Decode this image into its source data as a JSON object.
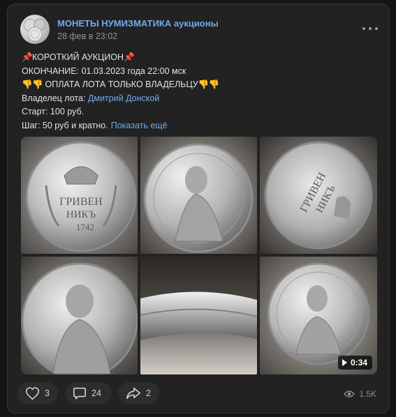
{
  "post": {
    "group_name": "МОНЕТЫ НУМИЗМАТИКА аукционы",
    "date": "28 фев в 23:02",
    "avatar_icon": "coins-avatar",
    "more_icon": "more-dots-icon"
  },
  "text": {
    "title": "КОРОТКИЙ АУКЦИОН",
    "end_line": "ОКОНЧАНИЕ: 01.03.2023 года 22:00 мск",
    "payment_line": "ОПЛАТА ЛОТА ТОЛЬКО ВЛАДЕЛЬЦУ",
    "owner_label": "Владелец лота:",
    "owner_name": "Дмитрий Донской",
    "start_line": "Старт: 100 руб.",
    "step_line": "Шаг: 50 руб и кратно.",
    "show_more": "Показать ещё",
    "pin_emoji": "📌",
    "thumb_emoji": "👎"
  },
  "gallery": {
    "video_duration": "0:34",
    "photos": [
      "coin-reverse-crown",
      "coin-obverse-portrait",
      "coin-reverse-tilted",
      "coin-obverse-closeup",
      "coin-edge",
      "coin-obverse-video"
    ]
  },
  "footer": {
    "likes": "3",
    "comments": "24",
    "shares": "2",
    "views": "1.5K"
  },
  "colors": {
    "link": "#71aaeb",
    "card_bg": "#222222",
    "page_bg": "#141414"
  }
}
